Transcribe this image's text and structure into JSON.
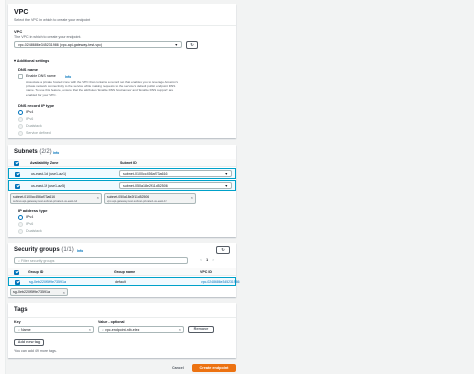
{
  "vpc": {
    "title": "VPC",
    "subtitle": "Select the VPC in which to create your endpoint",
    "field_label": "VPC",
    "field_hint": "The VPC in which to create your endpoint.",
    "selected": "vpc-0248686e345231986 (vpc-api-gateway-test-vpc)",
    "additional_settings": "Additional settings",
    "dns_name_label": "DNS name",
    "enable_dns_label": "Enable DNS name",
    "enable_dns_info": "Info",
    "dns_desc": "Associate a private hosted zone with the VPC that contains a record set that enables you to leverage Amazon's private network connectivity to the service while making requests to the service's default public endpoint DNS name. To use this feature, ensure that the attributes 'Enable DNS hostnames' and 'Enable DNS support' are enabled for your VPC.",
    "dns_record_ip_type_label": "DNS record IP type",
    "ip_options": [
      "IPv4",
      "IPv6",
      "Dualstack",
      "Service defined"
    ]
  },
  "subnets": {
    "title": "Subnets",
    "count": "(2/2)",
    "info": "Info",
    "col_az": "Availability Zone",
    "col_subnet": "Subnet ID",
    "rows": [
      {
        "az": "us-east-1d (use1-az1)",
        "subnet": "subnet-0100cc456af73a616"
      },
      {
        "az": "us-east-1f (use1-az5)",
        "subnet": "subnet-050a18e2f11d52506"
      }
    ],
    "tokens": [
      {
        "id": "subnet-0100cc456af73a616",
        "name": "subnet-api-gateway-test-subnet-private1-us-east-1d"
      },
      {
        "id": "subnet-050a18e2f11d52506",
        "name": "vpc-api-gateway-test-subnet-private2-us-east-1f"
      }
    ],
    "ip_address_type_label": "IP address type",
    "ip_options": [
      "IPv4",
      "IPv6",
      "Dualstack"
    ]
  },
  "security_groups": {
    "title": "Security groups",
    "count": "(1/1)",
    "info": "Info",
    "filter_placeholder": "Filter security groups",
    "pager_prev": "<",
    "pager_page": "1",
    "pager_next": ">",
    "col_group_id": "Group ID",
    "col_group_name": "Group name",
    "col_vpc_id": "VPC ID",
    "rows": [
      {
        "group_id": "sg-0eb220f5f9e73591a",
        "group_name": "default",
        "vpc_id": "vpc-0248686e345231986"
      }
    ],
    "token": "sg-0eb220f5f9e73591a"
  },
  "tags": {
    "title": "Tags",
    "key_label": "Key",
    "value_label": "Value - optional",
    "key_value": "Name",
    "value_value": "vpc-endpoint-nlb-elez",
    "remove_label": "Remove",
    "add_label": "Add new tag",
    "hint": "You can add 49 more tags."
  },
  "footer": {
    "cancel": "Cancel",
    "create": "Create endpoint"
  },
  "colors": {
    "accent": "#0073bb",
    "primary_button": "#ec7211"
  }
}
